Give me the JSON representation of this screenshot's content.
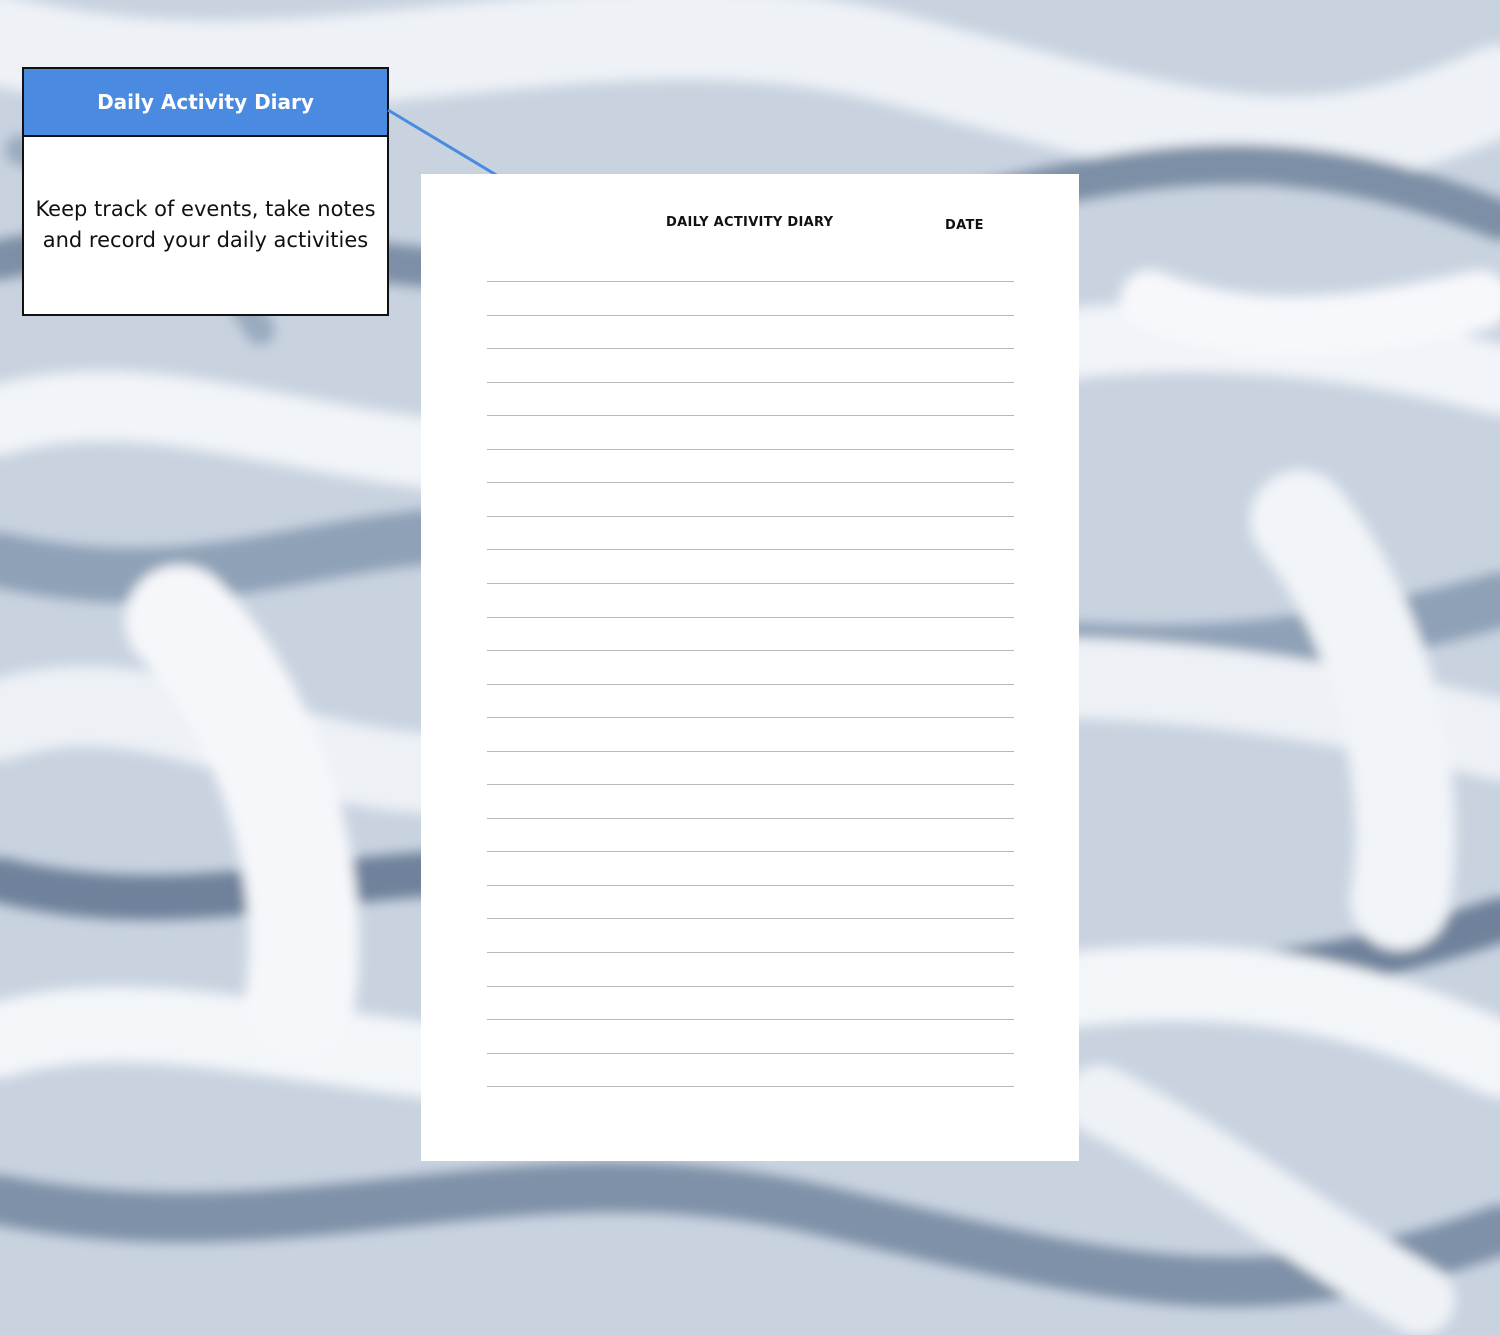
{
  "callout": {
    "title": "Daily Activity Diary",
    "description": "Keep track of events, take notes and record your daily activities",
    "header_color": "#4a8ae0"
  },
  "sheet": {
    "title": "DAILY ACTIVITY DIARY",
    "date_label": "DATE",
    "ruled_line_count": 25
  },
  "colors": {
    "arrow": "#4a8ae0",
    "marble_base": "#c9d3e0",
    "marble_dark": "#6f829b",
    "marble_light": "#f2f5f9"
  }
}
